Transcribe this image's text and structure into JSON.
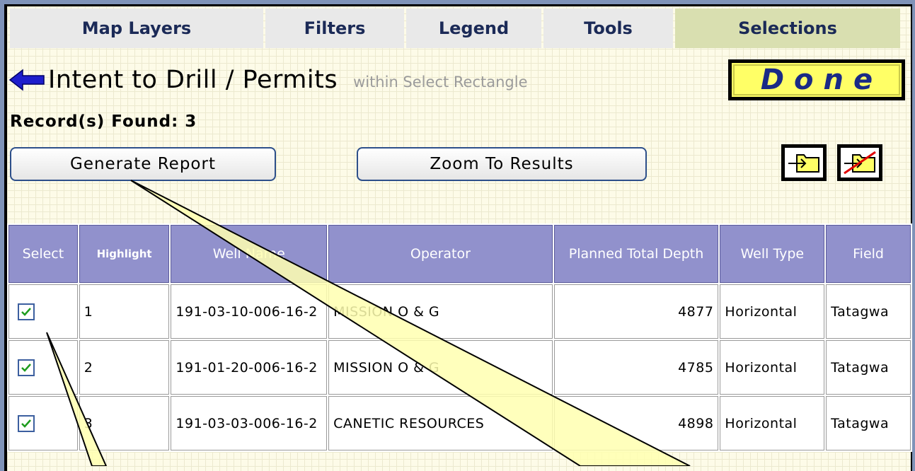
{
  "tabs": [
    "Map Layers",
    "Filters",
    "Legend",
    "Tools",
    "Selections"
  ],
  "active_tab": "Selections",
  "header": {
    "title": "Intent to Drill / Permits",
    "subtitle": "within Select Rectangle",
    "done_label": "Done"
  },
  "records_found": "Record(s) Found: 3",
  "buttons": {
    "generate_report": "Generate Report",
    "zoom_to_results": "Zoom To Results"
  },
  "table": {
    "headers": [
      "Select",
      "Highlight",
      "Well Name",
      "Operator",
      "Planned Total Depth",
      "Well Type",
      "Field"
    ],
    "rows": [
      {
        "selected": true,
        "highlight": "1",
        "well_name": "191-03-10-006-16-2",
        "operator": "MISSION O & G",
        "depth": "4877",
        "well_type": "Horizontal",
        "field": "Tatagwa"
      },
      {
        "selected": true,
        "highlight": "2",
        "well_name": "191-01-20-006-16-2",
        "operator": "MISSION O & G",
        "depth": "4785",
        "well_type": "Horizontal",
        "field": "Tatagwa"
      },
      {
        "selected": true,
        "highlight": "3",
        "well_name": "191-03-03-006-16-2",
        "operator": "CANETIC RESOURCES",
        "depth": "4898",
        "well_type": "Horizontal",
        "field": "Tatagwa"
      }
    ]
  },
  "icons": {
    "back": "back-arrow-icon",
    "select_all": "folder-arrow-icon",
    "clear_selection": "folder-cross-icon",
    "checkbox": "checkmark-icon"
  },
  "colors": {
    "tab_active": "#d9dfb0",
    "done_bg": "#ffff66",
    "header_bg": "#9191cc",
    "callout": "#ffffb0"
  }
}
